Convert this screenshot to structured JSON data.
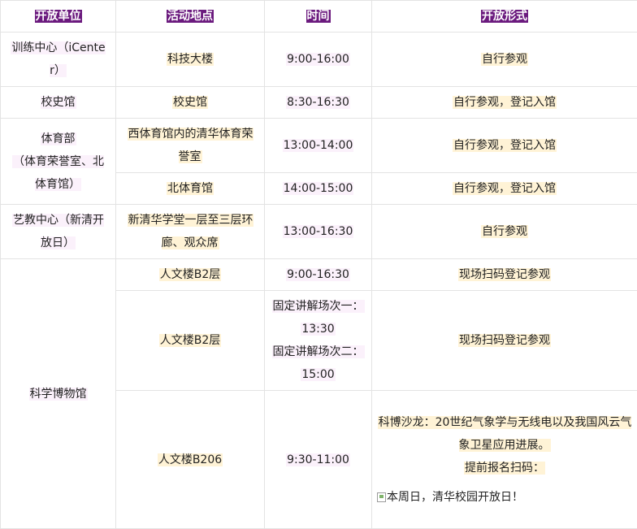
{
  "headers": [
    "开放单位",
    "活动地点",
    "时间",
    "开放形式"
  ],
  "rows": {
    "icenter": {
      "unit": "训练中心（iCenter）",
      "place": "科技大楼",
      "time": "9:00-16:00",
      "form": "自行参观"
    },
    "history": {
      "unit": "校史馆",
      "place": "校史馆",
      "time": "8:30-16:30",
      "form": "自行参观，登记入馆"
    },
    "sports": {
      "unit_line1": "体育部",
      "unit_line2": "（体育荣誉室、北体育馆）",
      "a": {
        "place": "西体育馆内的清华体育荣誉室",
        "time": "13:00-14:00",
        "form": "自行参观，登记入馆"
      },
      "b": {
        "place": "北体育馆",
        "time": "14:00-15:00",
        "form": "自行参观，登记入馆"
      }
    },
    "arts": {
      "unit": "艺教中心（新清开放日）",
      "place": "新清华学堂一层至三层环廊、观众席",
      "time": "13:00-16:30",
      "form": "自行参观"
    },
    "museum": {
      "unit": "科学博物馆",
      "a": {
        "place": "人文楼B2层",
        "time": "9:00-16:30",
        "form": "现场扫码登记参观"
      },
      "b": {
        "place": "人文楼B2层",
        "time1_label": "固定讲解场次一：",
        "time1": "13:30",
        "time2_label": "固定讲解场次二：",
        "time2": "15:00",
        "form": "现场扫码登记参观"
      },
      "c": {
        "place": "人文楼B206",
        "time": "9:30-11:00",
        "form_line1": "科博沙龙：20世纪气象学与无线电以及我国风云气象卫星应用进展。",
        "form_line2": "提前报名扫码：",
        "img_alt": "本周日，清华校园开放日！"
      }
    }
  }
}
